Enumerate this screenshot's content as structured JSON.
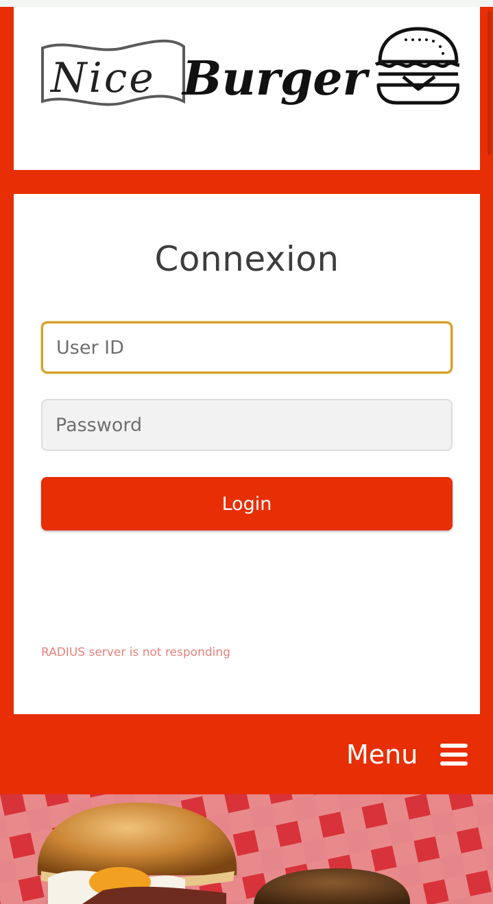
{
  "brand": {
    "logo_text_left": "Nice",
    "logo_text_right": "Burger",
    "logo_icon": "burger-icon"
  },
  "login": {
    "title": "Connexion",
    "user_id_placeholder": "User ID",
    "user_id_value": "",
    "password_placeholder": "Password",
    "password_value": "",
    "button_label": "Login",
    "error_message": "RADIUS server is not responding"
  },
  "nav": {
    "menu_label": "Menu",
    "menu_icon": "hamburger-menu-icon"
  },
  "hero": {
    "image_subject": "burger-on-checkered-tablecloth"
  },
  "colors": {
    "brand_red": "#e82e04",
    "focus_border": "#d4a027",
    "error_text": "#e8807a"
  }
}
